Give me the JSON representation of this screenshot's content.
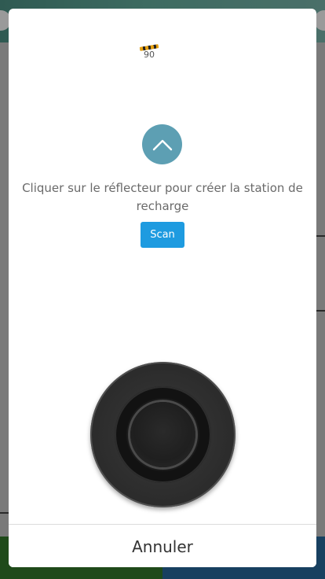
{
  "signal": {
    "value": "90"
  },
  "icons": {
    "up_button": "chevron-up-icon",
    "signal": "signal-strength-icon"
  },
  "instruction": {
    "text": "Cliquer sur le réflecteur pour créer la station de recharge"
  },
  "scan_button": {
    "label": "Scan"
  },
  "joystick": {
    "name": "joystick-control"
  },
  "footer": {
    "cancel_label": "Annuler"
  },
  "colors": {
    "up_button": "#5d9fb3",
    "scan_button": "#1e9be0",
    "instruction_text": "#6a6a6a"
  }
}
